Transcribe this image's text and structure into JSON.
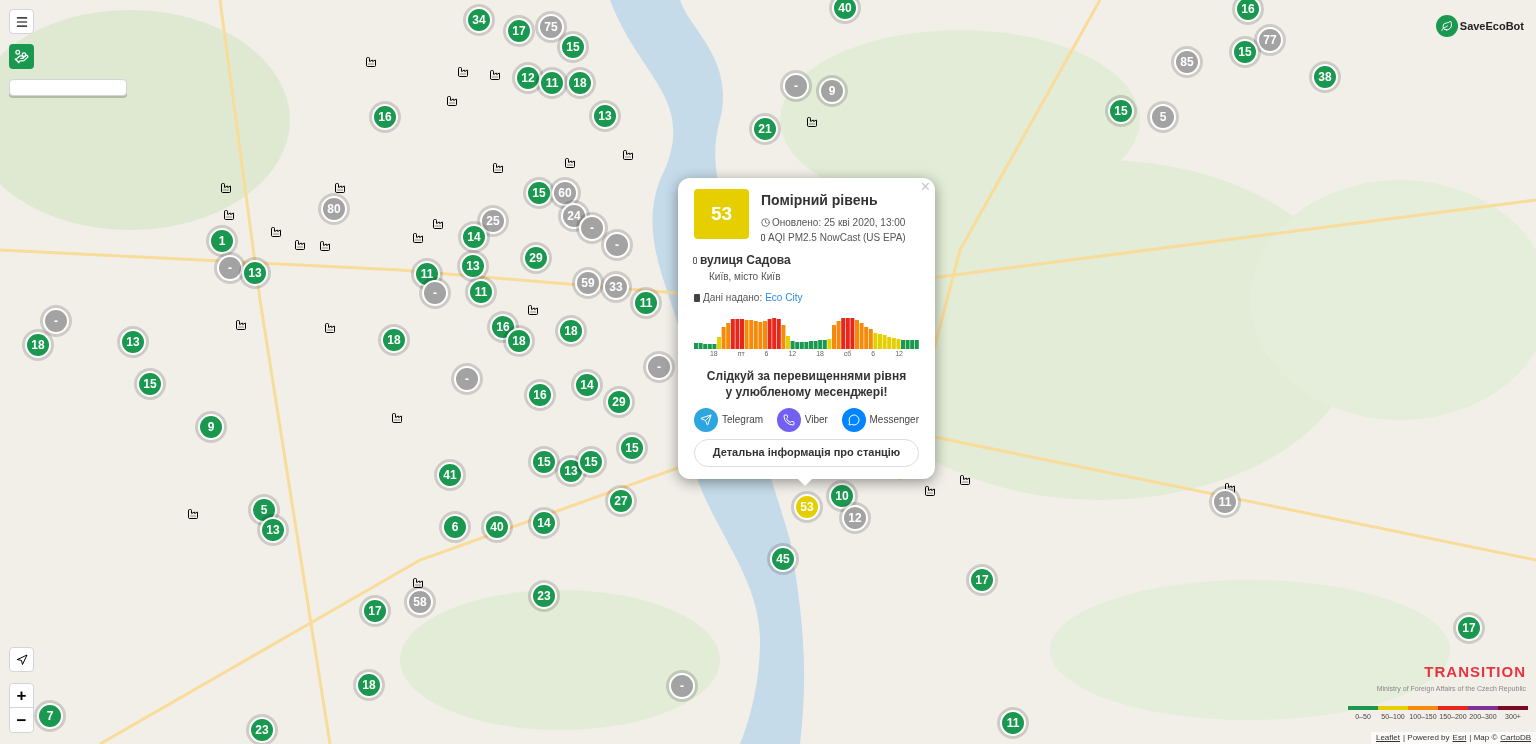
{
  "logo": {
    "text": "SaveEcoBot"
  },
  "markers": [
    {
      "label": "34",
      "color": "#1a9850"
    },
    {
      "label": "40",
      "color": "#1a9850"
    },
    {
      "label": "16",
      "color": "#1a9850"
    },
    {
      "label": "17",
      "color": "#1a9850"
    },
    {
      "label": "75",
      "color": "#a3a3a3"
    },
    {
      "label": "15",
      "color": "#1a9850"
    },
    {
      "label": "77",
      "color": "#a3a3a3"
    },
    {
      "label": "85",
      "color": "#a3a3a3"
    },
    {
      "label": "15",
      "color": "#1a9850"
    },
    {
      "label": "12",
      "color": "#1a9850"
    },
    {
      "label": "11",
      "color": "#1a9850"
    },
    {
      "label": "18",
      "color": "#1a9850"
    },
    {
      "label": "-",
      "color": "#a3a3a3"
    },
    {
      "label": "9",
      "color": "#a3a3a3"
    },
    {
      "label": "38",
      "color": "#1a9850"
    },
    {
      "label": "16",
      "color": "#1a9850"
    },
    {
      "label": "13",
      "color": "#1a9850"
    },
    {
      "label": "15",
      "color": "#1a9850"
    },
    {
      "label": "5",
      "color": "#a3a3a3"
    },
    {
      "label": "21",
      "color": "#1a9850"
    },
    {
      "label": "15",
      "color": "#1a9850"
    },
    {
      "label": "60",
      "color": "#a3a3a3"
    },
    {
      "label": "80",
      "color": "#a3a3a3"
    },
    {
      "label": "25",
      "color": "#a3a3a3"
    },
    {
      "label": "24",
      "color": "#a3a3a3"
    },
    {
      "label": "1",
      "color": "#1a9850"
    },
    {
      "label": "14",
      "color": "#1a9850"
    },
    {
      "label": "-",
      "color": "#a3a3a3"
    },
    {
      "label": "-",
      "color": "#a3a3a3"
    },
    {
      "label": "-",
      "color": "#a3a3a3"
    },
    {
      "label": "13",
      "color": "#1a9850"
    },
    {
      "label": "11",
      "color": "#1a9850"
    },
    {
      "label": "13",
      "color": "#1a9850"
    },
    {
      "label": "29",
      "color": "#1a9850"
    },
    {
      "label": "-",
      "color": "#a3a3a3"
    },
    {
      "label": "11",
      "color": "#1a9850"
    },
    {
      "label": "59",
      "color": "#a3a3a3"
    },
    {
      "label": "33",
      "color": "#a3a3a3"
    },
    {
      "label": "-",
      "color": "#a3a3a3"
    },
    {
      "label": "11",
      "color": "#1a9850"
    },
    {
      "label": "18",
      "color": "#1a9850"
    },
    {
      "label": "13",
      "color": "#1a9850"
    },
    {
      "label": "18",
      "color": "#1a9850"
    },
    {
      "label": "16",
      "color": "#1a9850"
    },
    {
      "label": "18",
      "color": "#1a9850"
    },
    {
      "label": "18",
      "color": "#1a9850"
    },
    {
      "label": "-",
      "color": "#a3a3a3"
    },
    {
      "label": "15",
      "color": "#1a9850"
    },
    {
      "label": "-",
      "color": "#a3a3a3"
    },
    {
      "label": "16",
      "color": "#1a9850"
    },
    {
      "label": "14",
      "color": "#1a9850"
    },
    {
      "label": "29",
      "color": "#1a9850"
    },
    {
      "label": "9",
      "color": "#1a9850"
    },
    {
      "label": "15",
      "color": "#1a9850"
    },
    {
      "label": "15",
      "color": "#1a9850"
    },
    {
      "label": "13",
      "color": "#1a9850"
    },
    {
      "label": "15",
      "color": "#1a9850"
    },
    {
      "label": "41",
      "color": "#1a9850"
    },
    {
      "label": "10",
      "color": "#1a9850"
    },
    {
      "label": "5",
      "color": "#1a9850"
    },
    {
      "label": "14",
      "color": "#1a9850"
    },
    {
      "label": "27",
      "color": "#1a9850"
    },
    {
      "label": "53",
      "color": "#e5cf00"
    },
    {
      "label": "12",
      "color": "#a3a3a3"
    },
    {
      "label": "11",
      "color": "#a3a3a3"
    },
    {
      "label": "13",
      "color": "#1a9850"
    },
    {
      "label": "6",
      "color": "#1a9850"
    },
    {
      "label": "40",
      "color": "#1a9850"
    },
    {
      "label": "45",
      "color": "#1a9850"
    },
    {
      "label": "23",
      "color": "#1a9850"
    },
    {
      "label": "17",
      "color": "#1a9850"
    },
    {
      "label": "17",
      "color": "#1a9850"
    },
    {
      "label": "58",
      "color": "#a3a3a3"
    },
    {
      "label": "17",
      "color": "#1a9850"
    },
    {
      "label": "18",
      "color": "#1a9850"
    },
    {
      "label": "-",
      "color": "#a3a3a3"
    },
    {
      "label": "7",
      "color": "#1a9850"
    },
    {
      "label": "11",
      "color": "#1a9850"
    },
    {
      "label": "23",
      "color": "#1a9850"
    }
  ],
  "popup": {
    "close": "×",
    "aqi": "53",
    "level": "Помірний рівень",
    "updated": "Оновлено: 25 кві 2020, 13:00",
    "index": "AQI PM2.5 NowCast (US EPA)",
    "station": "вулиця Садова",
    "city": "Київ, місто Київ",
    "provider_label": "Дані надано:",
    "provider_link": "Eco City",
    "chart_ticks": [
      "18",
      "пт",
      "6",
      "12",
      "18",
      "сб",
      "6",
      "12"
    ],
    "promo": "Слідкуй за перевищеннями рівня\nу улюбленому месенджері!",
    "messengers": [
      {
        "kind": "telegram",
        "label": "Telegram"
      },
      {
        "kind": "viber",
        "label": "Viber"
      },
      {
        "kind": "messenger",
        "label": "Messenger"
      }
    ],
    "details_button": "Детальна інформація про станцію"
  },
  "zoom": {
    "in": "+",
    "out": "−"
  },
  "sponsor": {
    "title": "TRANSITION",
    "subtitle": "Ministry of Foreign Affairs of the Czech Republic"
  },
  "legend": [
    {
      "label": "0–50",
      "color": "#1a9850"
    },
    {
      "label": "50–100",
      "color": "#e5cf00"
    },
    {
      "label": "100–150",
      "color": "#f58a0b"
    },
    {
      "label": "150–200",
      "color": "#e8261c"
    },
    {
      "label": "200–300",
      "color": "#7b3294"
    },
    {
      "label": "300+",
      "color": "#7a0a23"
    }
  ],
  "attribution": [
    {
      "kind": "link",
      "text": "Leaflet"
    },
    {
      "kind": "text",
      "text": "| Powered by"
    },
    {
      "kind": "link",
      "text": "Esri"
    },
    {
      "kind": "text",
      "text": "| Map ©"
    },
    {
      "kind": "link",
      "text": "CartoDB"
    }
  ]
}
